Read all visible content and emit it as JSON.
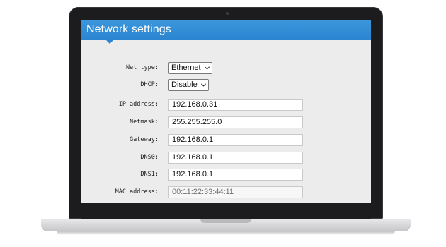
{
  "window": {
    "title": "Network settings"
  },
  "form": {
    "net_type": {
      "label": "Net type:",
      "value": "Ethernet"
    },
    "dhcp": {
      "label": "DHCP:",
      "value": "Disable"
    },
    "ip_address": {
      "label": "IP address:",
      "value": "192.168.0.31"
    },
    "netmask": {
      "label": "Netmask:",
      "value": "255.255.255.0"
    },
    "gateway": {
      "label": "Gateway:",
      "value": "192.168.0.1"
    },
    "dns0": {
      "label": "DNS0:",
      "value": "192.168.0.1"
    },
    "dns1": {
      "label": "DNS1:",
      "value": "192.168.0.1"
    },
    "mac_address": {
      "label": "MAC address:",
      "value": "00:11:22:33:44:11"
    }
  },
  "icons": {
    "dropdown": "chevron-down-icon"
  },
  "colors": {
    "title_bar": "#2a84d0",
    "screen_bg": "#ececec",
    "frame": "#1c1c1e"
  }
}
